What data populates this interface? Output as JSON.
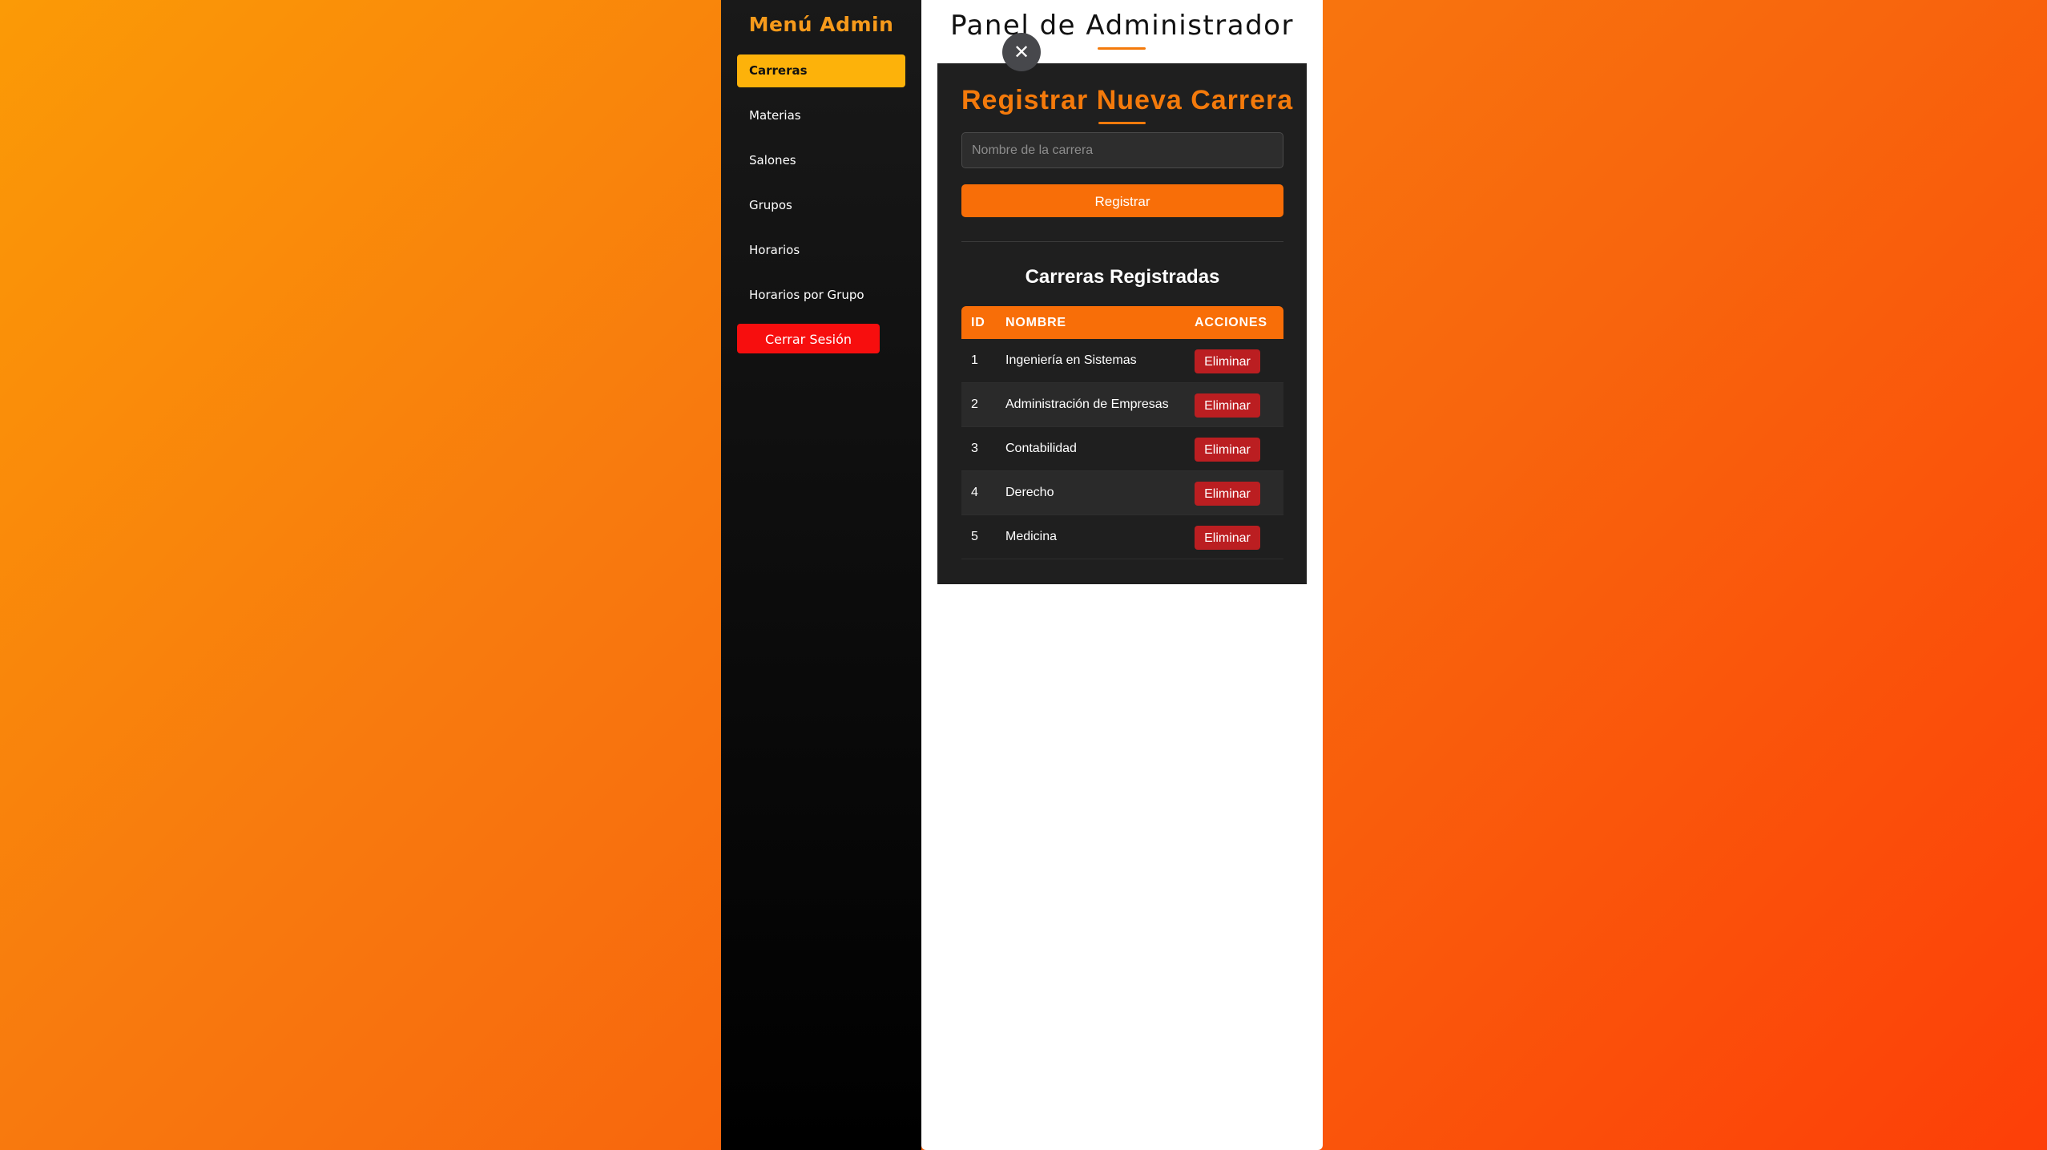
{
  "sidebar": {
    "title": "Menú Admin",
    "items": [
      {
        "label": "Carreras",
        "active": true
      },
      {
        "label": "Materias",
        "active": false
      },
      {
        "label": "Salones",
        "active": false
      },
      {
        "label": "Grupos",
        "active": false
      },
      {
        "label": "Horarios",
        "active": false
      },
      {
        "label": "Horarios por Grupo",
        "active": false
      }
    ],
    "logout_label": "Cerrar Sesión"
  },
  "main": {
    "title": "Panel de Administrador",
    "close_icon": "close-icon",
    "close_glyph": "✕"
  },
  "form": {
    "title": "Registrar Nueva Carrera",
    "name_placeholder": "Nombre de la carrera",
    "name_value": "",
    "submit_label": "Registrar"
  },
  "table": {
    "title": "Carreras Registradas",
    "headers": {
      "id": "ID",
      "name": "NOMBRE",
      "actions": "ACCIONES"
    },
    "rows": [
      {
        "id": "1",
        "name": "Ingeniería en Sistemas",
        "action": "Eliminar"
      },
      {
        "id": "2",
        "name": "Administración de Empresas",
        "action": "Eliminar"
      },
      {
        "id": "3",
        "name": "Contabilidad",
        "action": "Eliminar"
      },
      {
        "id": "4",
        "name": "Derecho",
        "action": "Eliminar"
      },
      {
        "id": "5",
        "name": "Medicina",
        "action": "Eliminar"
      }
    ]
  },
  "colors": {
    "accent": "#f86e08",
    "active_menu": "#fdb20a",
    "logout": "#f70e0e",
    "delete": "#bb1e21"
  }
}
